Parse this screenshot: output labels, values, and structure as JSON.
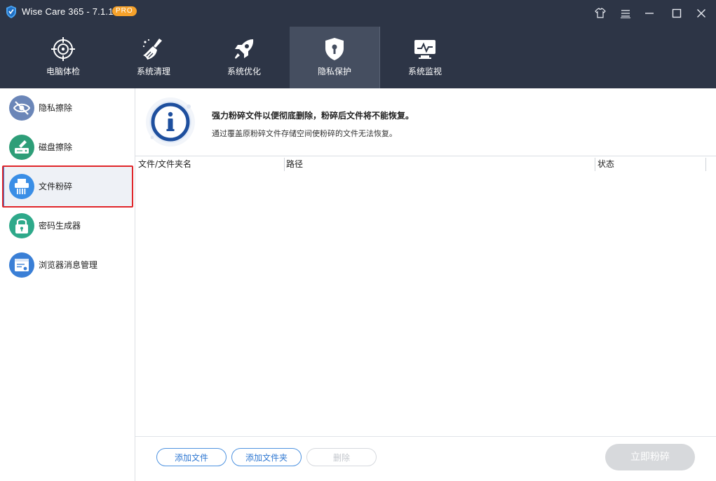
{
  "window": {
    "title": "Wise Care 365 - 7.1.1",
    "badge": "PRO"
  },
  "topnav": {
    "items": [
      {
        "label": "电脑体检",
        "icon": "target-icon"
      },
      {
        "label": "系统清理",
        "icon": "broom-icon"
      },
      {
        "label": "系统优化",
        "icon": "rocket-icon"
      },
      {
        "label": "隐私保护",
        "icon": "shield-keyhole-icon"
      },
      {
        "label": "系统监视",
        "icon": "monitor-icon"
      }
    ],
    "active_index": 3
  },
  "sidebar": {
    "items": [
      {
        "label": "隐私擦除",
        "icon": "eye-slash-icon",
        "color": "#6b86b8"
      },
      {
        "label": "磁盘擦除",
        "icon": "disk-erase-icon",
        "color": "#2e9e78"
      },
      {
        "label": "文件粉碎",
        "icon": "shredder-icon",
        "color": "#3a8ee6"
      },
      {
        "label": "密码生成器",
        "icon": "lock-icon",
        "color": "#2ea98a"
      },
      {
        "label": "浏览器消息管理",
        "icon": "browser-icon",
        "color": "#3a7fd6"
      }
    ],
    "active_index": 2
  },
  "main": {
    "info_title": "强力粉碎文件以便彻底删除，粉碎后文件将不能恢复。",
    "info_subtitle": "通过覆盖原粉碎文件存储空间使粉碎的文件无法恢复。",
    "table": {
      "columns": [
        "文件/文件夹名",
        "路径",
        "状态"
      ],
      "rows": []
    },
    "buttons": {
      "add_file": "添加文件",
      "add_folder": "添加文件夹",
      "delete": "删除",
      "shred_now": "立即粉碎"
    }
  },
  "colors": {
    "header_bg": "#2d3546",
    "active_tab_bg": "#454e60",
    "accent_blue": "#2f78d2",
    "badge_orange": "#f6a22b",
    "highlight_red": "#e0262a"
  }
}
